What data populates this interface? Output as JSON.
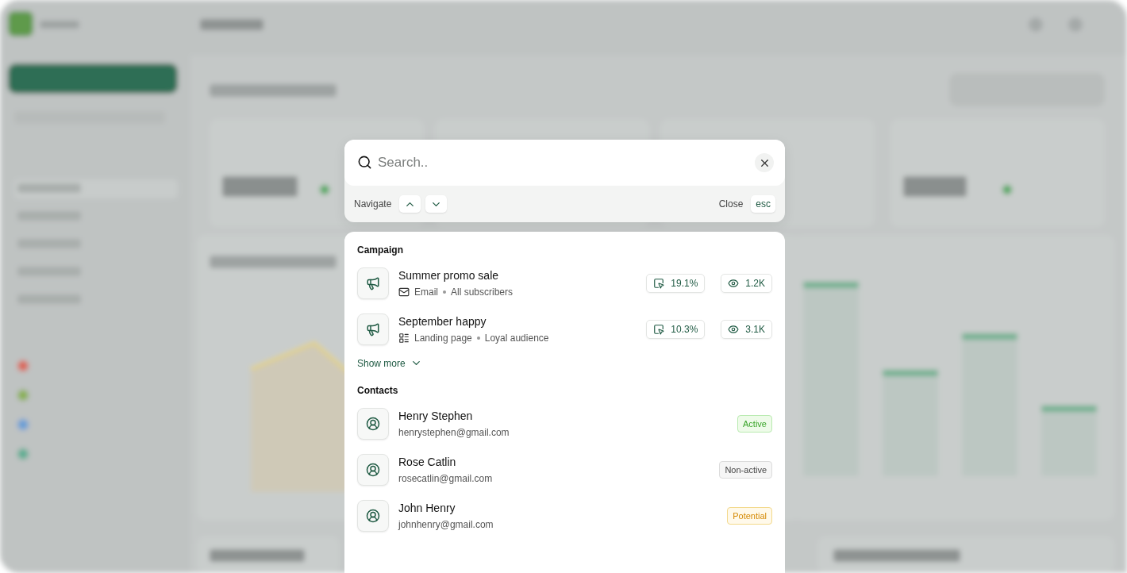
{
  "search": {
    "placeholder": "Search.."
  },
  "hints": {
    "navigate_label": "Navigate",
    "close_label": "Close",
    "close_key": "esc"
  },
  "campaign": {
    "heading": "Campaign",
    "show_more": "Show more",
    "items": [
      {
        "name": "Summer promo sale",
        "kind": "email",
        "channel": "Email",
        "audience": "All subscribers",
        "click_rate": "19.1%",
        "views": "1.2K"
      },
      {
        "name": "September happy",
        "kind": "landing",
        "channel": "Landing page",
        "audience": "Loyal audience",
        "click_rate": "10.3%",
        "views": "3.1K"
      }
    ]
  },
  "contacts": {
    "heading": "Contacts",
    "items": [
      {
        "name": "Henry Stephen",
        "email": "henrystephen@gmail.com",
        "status": "Active",
        "kind": "active"
      },
      {
        "name": "Rose Catlin",
        "email": "rosecatlin@gmail.com",
        "status": "Non-active",
        "kind": "inactive"
      },
      {
        "name": "John Henry",
        "email": "johnhenry@gmail.com",
        "status": "Potential",
        "kind": "potential"
      }
    ]
  }
}
